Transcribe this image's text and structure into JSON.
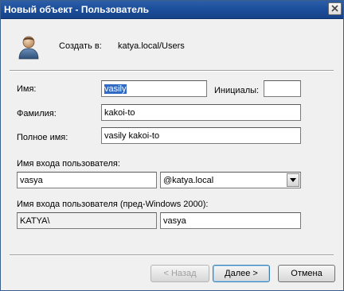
{
  "window": {
    "title": "Новый объект - Пользователь"
  },
  "header": {
    "icon": "user-icon",
    "create_label": "Создать в:",
    "create_path": "katya.local/Users"
  },
  "form": {
    "first_name": {
      "label": "Имя:",
      "value": "vasily",
      "selected": true
    },
    "initials": {
      "label": "Инициалы:",
      "value": ""
    },
    "last_name": {
      "label": "Фамилия:",
      "value": "kakoi-to"
    },
    "full_name": {
      "label": "Полное имя:",
      "value": "vasily kakoi-to"
    },
    "logon_name": {
      "label": "Имя входа пользователя:",
      "value": "vasya",
      "domain_value": "@katya.local"
    },
    "pre2000_logon": {
      "label": "Имя входа пользователя (пред-Windows 2000):",
      "domain_value": "KATYA\\",
      "value": "vasya"
    }
  },
  "buttons": {
    "back": {
      "label": "< Назад",
      "enabled": false
    },
    "next": {
      "label": "Далее >",
      "enabled": true,
      "default": true
    },
    "cancel": {
      "label": "Отмена",
      "enabled": true
    }
  }
}
